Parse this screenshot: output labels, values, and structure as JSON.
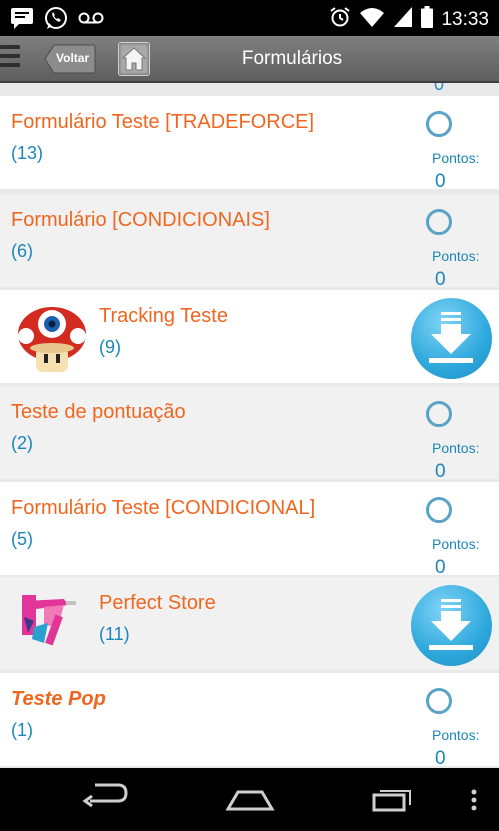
{
  "status_bar": {
    "time": "13:33",
    "left_icons": [
      "message-icon",
      "whatsapp-icon",
      "voicemail-icon"
    ],
    "right_icons": [
      "alarm-icon",
      "wifi-icon",
      "signal-icon",
      "battery-icon"
    ]
  },
  "header": {
    "back_label": "Voltar",
    "title": "Formulários"
  },
  "list": {
    "peek_value": "0",
    "items": [
      {
        "title": "Formulário Teste [TRADEFORCE]",
        "count": "(13)",
        "points_label": "Pontos:",
        "points": "0"
      },
      {
        "title": "Formulário [CONDICIONAIS]",
        "count": "(6)",
        "points_label": "Pontos:",
        "points": "0"
      },
      {
        "title": "Tracking Teste",
        "count": "(9)",
        "action": "download-icon"
      },
      {
        "title": "Teste de pontuação",
        "count": "(2)",
        "points_label": "Pontos:",
        "points": "0"
      },
      {
        "title": "Formulário Teste [CONDICIONAL]",
        "count": "(5)",
        "points_label": "Pontos:",
        "points": "0"
      },
      {
        "title": "Perfect Store",
        "count": "(11)",
        "action": "download-icon"
      },
      {
        "title": "Teste Pop",
        "count": "(1)",
        "points_label": "Pontos:",
        "points": "0"
      }
    ]
  },
  "nav_bar": {
    "icons": [
      "back-icon",
      "home-icon",
      "recent-apps-icon",
      "overflow-menu-icon"
    ]
  },
  "colors": {
    "title": "#f0661f",
    "accent": "#1b86b8",
    "header": "#6e6e6e"
  }
}
